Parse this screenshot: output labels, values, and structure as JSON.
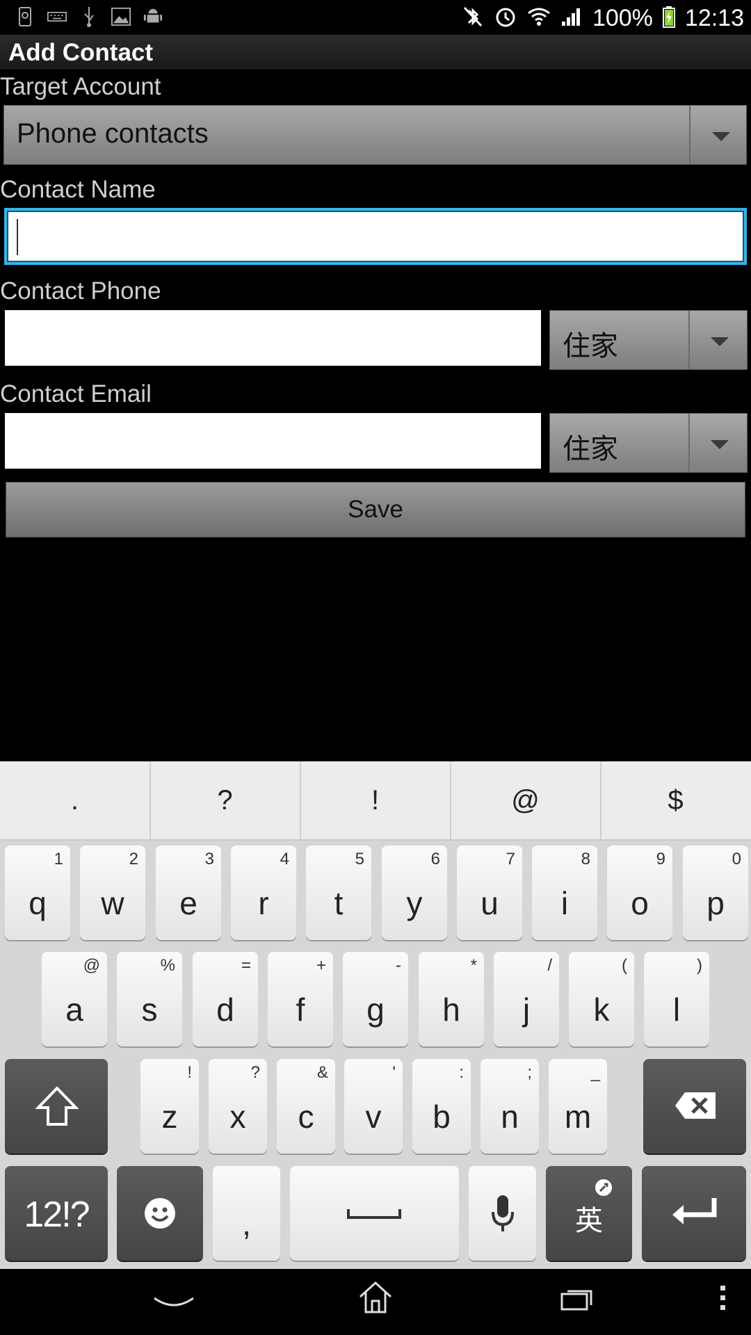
{
  "status": {
    "battery": "100%",
    "time": "12:13"
  },
  "app": {
    "title": "Add Contact"
  },
  "form": {
    "target_account_label": "Target Account",
    "target_account_value": "Phone contacts",
    "name_label": "Contact Name",
    "name_value": "",
    "phone_label": "Contact Phone",
    "phone_value": "",
    "phone_type": "住家",
    "email_label": "Contact Email",
    "email_value": "",
    "email_type": "住家",
    "save_label": "Save"
  },
  "keyboard": {
    "suggestions": [
      ".",
      "?",
      "!",
      "@",
      "$"
    ],
    "row1": [
      {
        "k": "q",
        "s": "1"
      },
      {
        "k": "w",
        "s": "2"
      },
      {
        "k": "e",
        "s": "3"
      },
      {
        "k": "r",
        "s": "4"
      },
      {
        "k": "t",
        "s": "5"
      },
      {
        "k": "y",
        "s": "6"
      },
      {
        "k": "u",
        "s": "7"
      },
      {
        "k": "i",
        "s": "8"
      },
      {
        "k": "o",
        "s": "9"
      },
      {
        "k": "p",
        "s": "0"
      }
    ],
    "row2": [
      {
        "k": "a",
        "s": "@"
      },
      {
        "k": "s",
        "s": "%"
      },
      {
        "k": "d",
        "s": "="
      },
      {
        "k": "f",
        "s": "+"
      },
      {
        "k": "g",
        "s": "-"
      },
      {
        "k": "h",
        "s": "*"
      },
      {
        "k": "j",
        "s": "/"
      },
      {
        "k": "k",
        "s": "("
      },
      {
        "k": "l",
        "s": ")"
      }
    ],
    "row3": [
      {
        "k": "z",
        "s": "!"
      },
      {
        "k": "x",
        "s": "?"
      },
      {
        "k": "c",
        "s": "&"
      },
      {
        "k": "v",
        "s": "'"
      },
      {
        "k": "b",
        "s": ":"
      },
      {
        "k": "n",
        "s": ";"
      },
      {
        "k": "m",
        "s": "_"
      }
    ],
    "symbols_label": "12!?",
    "comma_label": ",",
    "lang_label": "英"
  }
}
